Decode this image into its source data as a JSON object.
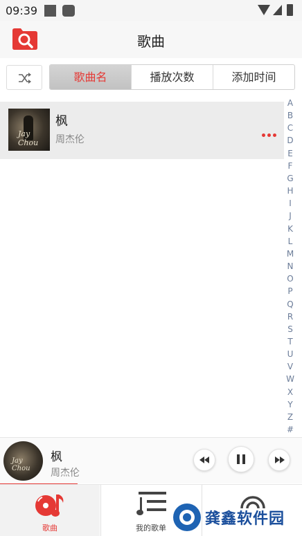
{
  "status_bar": {
    "time": "09:39"
  },
  "header": {
    "title": "歌曲",
    "search_icon": "search-folder-icon",
    "accent": "#e53935"
  },
  "toolbar": {
    "shuffle_icon": "shuffle-icon",
    "sort_tabs": [
      {
        "label": "歌曲名",
        "active": true
      },
      {
        "label": "播放次数",
        "active": false
      },
      {
        "label": "添加时间",
        "active": false
      }
    ]
  },
  "songs": [
    {
      "title": "枫",
      "artist": "周杰伦",
      "cover_text": "Jay Chou",
      "more_icon": "more-dots-icon"
    }
  ],
  "alphabet_index": [
    "A",
    "B",
    "C",
    "D",
    "E",
    "F",
    "G",
    "H",
    "I",
    "J",
    "K",
    "L",
    "M",
    "N",
    "O",
    "P",
    "Q",
    "R",
    "S",
    "T",
    "U",
    "V",
    "W",
    "X",
    "Y",
    "Z",
    "#"
  ],
  "now_playing": {
    "title": "枫",
    "artist": "周杰伦",
    "cover_text": "Jay Chou"
  },
  "bottom_nav": [
    {
      "label": "歌曲",
      "icon": "music-disc-icon",
      "active": true
    },
    {
      "label": "我的歌单",
      "icon": "playlist-icon",
      "active": false
    },
    {
      "label": "",
      "icon": "broadcast-icon",
      "active": false
    }
  ],
  "watermark": {
    "text": "龚鑫软件园"
  },
  "colors": {
    "accent": "#e53935",
    "selected_row": "#ececec",
    "index_text": "#6b7c98"
  }
}
